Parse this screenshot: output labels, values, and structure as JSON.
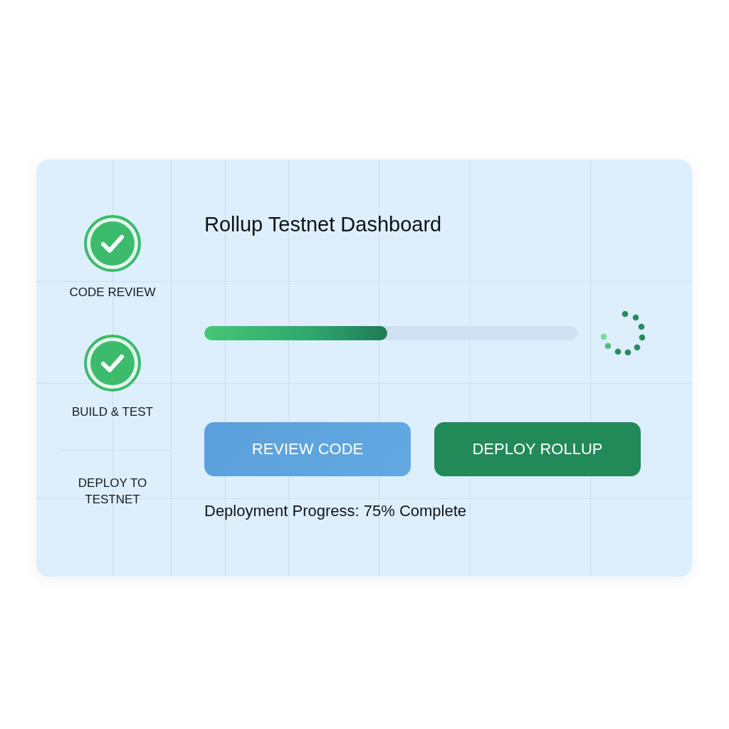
{
  "steps": [
    {
      "label": "CODE REVIEW",
      "done": true
    },
    {
      "label": "BUILD & TEST",
      "done": true
    },
    {
      "label": "DEPLOY TO TESTNET",
      "done": false
    }
  ],
  "header": {
    "title": "Rollup Testnet Dashboard"
  },
  "progress": {
    "level": 0.49
  },
  "buttons": [
    {
      "label": "REVIEW CODE",
      "kind": "secondary"
    },
    {
      "label": "DEPLOY ROLLUP",
      "kind": "primary"
    }
  ],
  "status_text": "Deployment Progress: 75% Complete"
}
